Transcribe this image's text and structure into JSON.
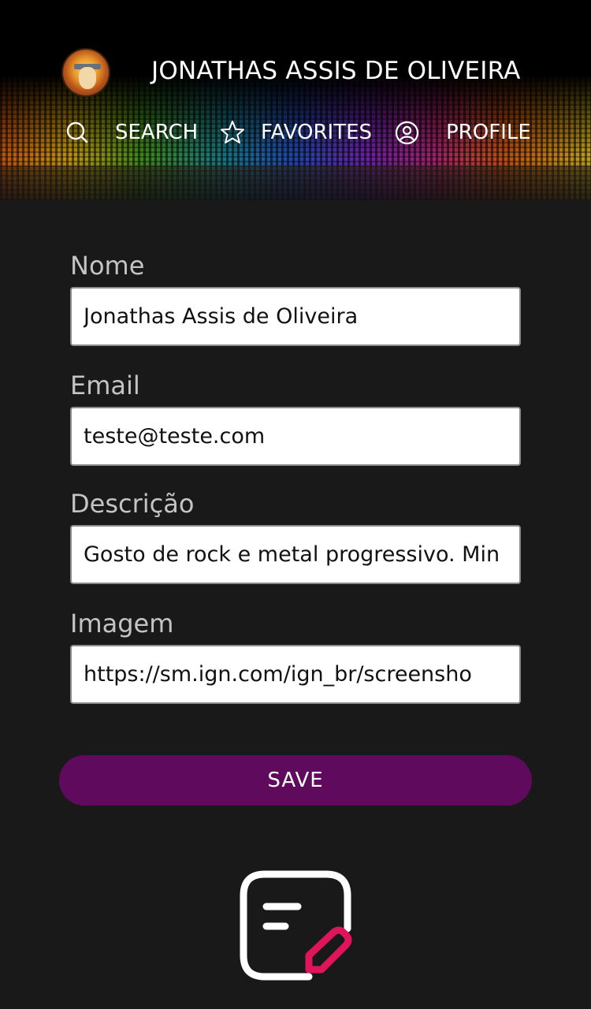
{
  "header": {
    "user_name": "JONATHAS ASSIS DE OLIVEIRA",
    "avatar_icon": "user-avatar",
    "nav": [
      {
        "label": "SEARCH",
        "icon": "search-icon"
      },
      {
        "label": "FAVORITES",
        "icon": "star-icon"
      },
      {
        "label": "PROFILE",
        "icon": "user-circle-icon"
      }
    ]
  },
  "form": {
    "name": {
      "label": "Nome",
      "value": "Jonathas Assis de Oliveira"
    },
    "email": {
      "label": "Email",
      "value": "teste@teste.com"
    },
    "description": {
      "label": "Descrição",
      "value": "Gosto de rock e metal progressivo. Min"
    },
    "image": {
      "label": "Imagem",
      "value": "https://sm.ign.com/ign_br/screensho"
    },
    "save_label": "SAVE"
  },
  "footer": {
    "icon": "edit-document-icon"
  },
  "colors": {
    "background": "#191919",
    "button": "#5f0a5c",
    "icon_accent": "#e0145a"
  }
}
